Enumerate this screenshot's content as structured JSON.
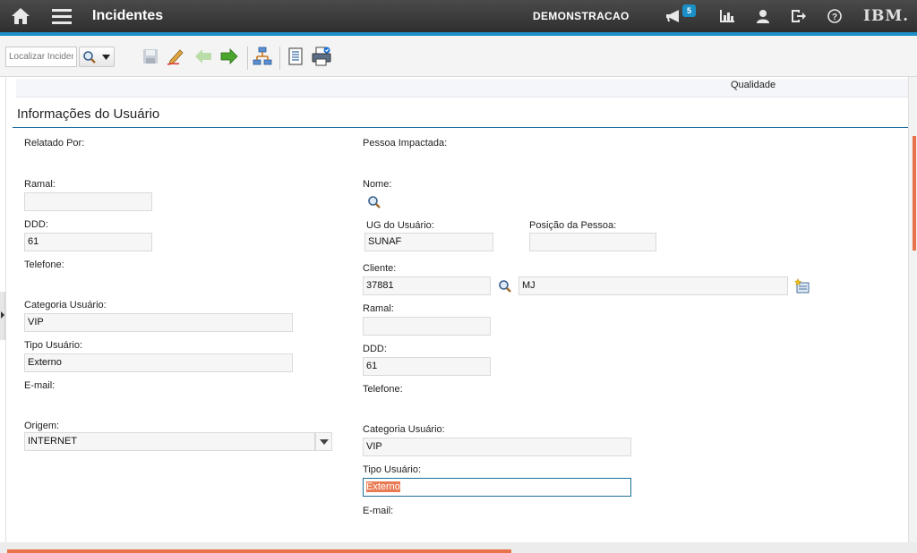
{
  "header": {
    "title": "Incidentes",
    "organization": "DEMONSTRACAO",
    "notification_count": "5",
    "brand": "IBM."
  },
  "toolbar": {
    "search_placeholder": "Localizar Incidente"
  },
  "top_strip": {
    "qualidade_label": "Qualidade"
  },
  "section": {
    "title": "Informações do Usuário"
  },
  "reported_by": {
    "heading": "Relatado Por:",
    "ramal_label": "Ramal:",
    "ramal_value": "",
    "ddd_label": "DDD:",
    "ddd_value": "61",
    "telefone_label": "Telefone:",
    "categoria_label": "Categoria Usuário:",
    "categoria_value": "VIP",
    "tipo_label": "Tipo Usuário:",
    "tipo_value": "Externo",
    "email_label": "E-mail:",
    "origem_label": "Origem:",
    "origem_value": "INTERNET"
  },
  "affected_person": {
    "heading": "Pessoa Impactada:",
    "nome_label": "Nome:",
    "ug_label": "UG do Usuário:",
    "ug_value": "SUNAF",
    "posicao_label": "Posição da Pessoa:",
    "posicao_value": "",
    "cliente_label": "Cliente:",
    "cliente_value": "37881",
    "cliente_desc": "MJ",
    "ramal_label": "Ramal:",
    "ramal_value": "",
    "ddd_label": "DDD:",
    "ddd_value": "61",
    "telefone_label": "Telefone:",
    "categoria_label": "Categoria Usuário:",
    "categoria_value": "VIP",
    "tipo_label": "Tipo Usuário:",
    "tipo_value": "Externo",
    "email_label": "E-mail:"
  },
  "colors": {
    "accent": "#1b8fc7",
    "header_bg": "#3a3a3a",
    "highlight": "#e97b55"
  }
}
